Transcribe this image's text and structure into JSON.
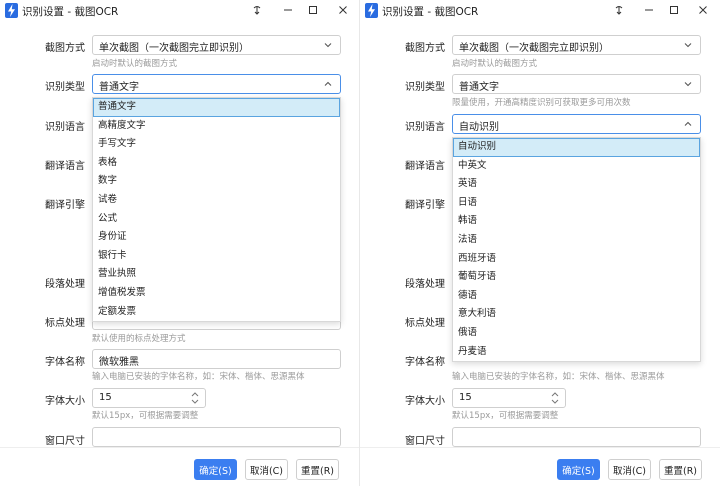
{
  "windows": [
    {
      "title": "识别设置 - 截图OCR",
      "capture_label": "截图方式",
      "capture_value": "单次截图（一次截图完立即识别）",
      "capture_hint": "启动时默认的截图方式",
      "type_label": "识别类型",
      "type_value": "普通文字",
      "lang_label": "识别语言",
      "translate_lang_label": "翻译语言",
      "translate_engine_label": "翻译引擎",
      "paragraph_label": "段落处理",
      "punct_label": "标点处理",
      "punct_hint": "默认使用的标点处理方式",
      "font_name_label": "字体名称",
      "font_name_value": "微软雅黑",
      "font_name_hint": "输入电脑已安装的字体名称，如：宋体、楷体、思源黑体",
      "font_size_label": "字体大小",
      "font_size_value": "15",
      "font_size_hint": "默认15px，可根据需要调整",
      "window_size_label": "窗口尺寸",
      "dropdown_options": [
        "普通文字",
        "高精度文字",
        "手写文字",
        "表格",
        "数字",
        "试卷",
        "公式",
        "身份证",
        "银行卡",
        "营业执照",
        "增值税发票",
        "定额发票"
      ],
      "ok_label": "确定(S)",
      "cancel_label": "取消(C)",
      "reset_label": "重置(R)"
    },
    {
      "title": "识别设置 - 截图OCR",
      "capture_label": "截图方式",
      "capture_value": "单次截图（一次截图完立即识别）",
      "capture_hint": "启动时默认的截图方式",
      "type_label": "识别类型",
      "type_value": "普通文字",
      "type_hint": "限量使用，开通高精度识别可获取更多可用次数",
      "lang_label": "识别语言",
      "lang_value": "自动识别",
      "translate_lang_label": "翻译语言",
      "translate_engine_label": "翻译引擎",
      "paragraph_label": "段落处理",
      "punct_label": "标点处理",
      "font_name_label": "字体名称",
      "font_name_hint": "输入电脑已安装的字体名称，如：宋体、楷体、思源黑体",
      "font_size_label": "字体大小",
      "font_size_value": "15",
      "font_size_hint": "默认15px，可根据需要调整",
      "window_size_label": "窗口尺寸",
      "dropdown_options": [
        "自动识别",
        "中英文",
        "英语",
        "日语",
        "韩语",
        "法语",
        "西班牙语",
        "葡萄牙语",
        "德语",
        "意大利语",
        "俄语",
        "丹麦语"
      ],
      "ok_label": "确定(S)",
      "cancel_label": "取消(C)",
      "reset_label": "重置(R)"
    }
  ],
  "colors": {
    "accent": "#3b7ef0",
    "selected_bg": "#d3ecf8",
    "selected_border": "#5aa4e0",
    "hint": "#9a9a9a"
  },
  "icons": {
    "app": "lightning-icon",
    "pin": "pin-icon",
    "minimize": "minimize-icon",
    "maximize": "maximize-icon",
    "close": "close-icon",
    "chevron_down": "chevron-down-icon",
    "chevron_up": "chevron-up-icon"
  }
}
